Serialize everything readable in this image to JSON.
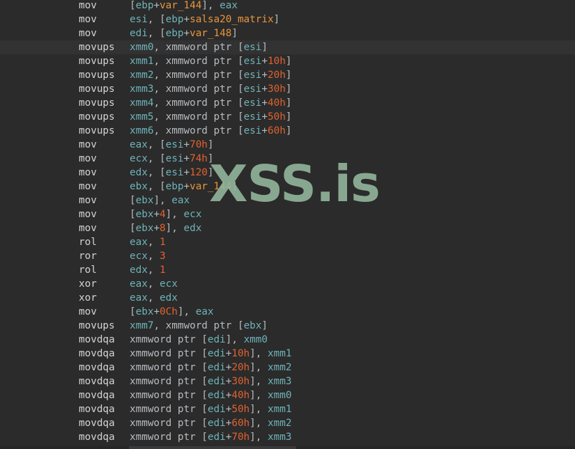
{
  "watermark": "XSS.is",
  "colors": {
    "background": "#2b2b2b",
    "current_line": "#323232",
    "mnemonic": "#d4d4d4",
    "register": "#6fb3b8",
    "punctuation": "#b8bcc0",
    "symbol": "#e8963a",
    "number": "#e0622f",
    "watermark": "#93b59c"
  },
  "lines": [
    {
      "mnemonic": "mov",
      "operands": [
        [
          "p",
          "["
        ],
        [
          "r",
          "ebp"
        ],
        [
          "p",
          "+"
        ],
        [
          "s",
          "var_144"
        ],
        [
          "p",
          "], "
        ],
        [
          "r",
          "eax"
        ]
      ]
    },
    {
      "mnemonic": "mov",
      "operands": [
        [
          "r",
          "esi"
        ],
        [
          "p",
          ", ["
        ],
        [
          "r",
          "ebp"
        ],
        [
          "p",
          "+"
        ],
        [
          "s",
          "salsa20_matrix"
        ],
        [
          "p",
          "]"
        ]
      ]
    },
    {
      "mnemonic": "mov",
      "operands": [
        [
          "r",
          "edi"
        ],
        [
          "p",
          ", ["
        ],
        [
          "r",
          "ebp"
        ],
        [
          "p",
          "+"
        ],
        [
          "s",
          "var_148"
        ],
        [
          "p",
          "]"
        ]
      ]
    },
    {
      "mnemonic": "movups",
      "current": true,
      "operands": [
        [
          "r",
          "xmm0"
        ],
        [
          "p",
          ", "
        ],
        [
          "k",
          "xmmword ptr "
        ],
        [
          "p",
          "["
        ],
        [
          "r",
          "esi"
        ],
        [
          "p",
          "]"
        ]
      ]
    },
    {
      "mnemonic": "movups",
      "operands": [
        [
          "r",
          "xmm1"
        ],
        [
          "p",
          ", "
        ],
        [
          "k",
          "xmmword ptr "
        ],
        [
          "p",
          "["
        ],
        [
          "r",
          "esi"
        ],
        [
          "p",
          "+"
        ],
        [
          "n",
          "10h"
        ],
        [
          "p",
          "]"
        ]
      ]
    },
    {
      "mnemonic": "movups",
      "operands": [
        [
          "r",
          "xmm2"
        ],
        [
          "p",
          ", "
        ],
        [
          "k",
          "xmmword ptr "
        ],
        [
          "p",
          "["
        ],
        [
          "r",
          "esi"
        ],
        [
          "p",
          "+"
        ],
        [
          "n",
          "20h"
        ],
        [
          "p",
          "]"
        ]
      ]
    },
    {
      "mnemonic": "movups",
      "operands": [
        [
          "r",
          "xmm3"
        ],
        [
          "p",
          ", "
        ],
        [
          "k",
          "xmmword ptr "
        ],
        [
          "p",
          "["
        ],
        [
          "r",
          "esi"
        ],
        [
          "p",
          "+"
        ],
        [
          "n",
          "30h"
        ],
        [
          "p",
          "]"
        ]
      ]
    },
    {
      "mnemonic": "movups",
      "operands": [
        [
          "r",
          "xmm4"
        ],
        [
          "p",
          ", "
        ],
        [
          "k",
          "xmmword ptr "
        ],
        [
          "p",
          "["
        ],
        [
          "r",
          "esi"
        ],
        [
          "p",
          "+"
        ],
        [
          "n",
          "40h"
        ],
        [
          "p",
          "]"
        ]
      ]
    },
    {
      "mnemonic": "movups",
      "operands": [
        [
          "r",
          "xmm5"
        ],
        [
          "p",
          ", "
        ],
        [
          "k",
          "xmmword ptr "
        ],
        [
          "p",
          "["
        ],
        [
          "r",
          "esi"
        ],
        [
          "p",
          "+"
        ],
        [
          "n",
          "50h"
        ],
        [
          "p",
          "]"
        ]
      ]
    },
    {
      "mnemonic": "movups",
      "operands": [
        [
          "r",
          "xmm6"
        ],
        [
          "p",
          ", "
        ],
        [
          "k",
          "xmmword ptr "
        ],
        [
          "p",
          "["
        ],
        [
          "r",
          "esi"
        ],
        [
          "p",
          "+"
        ],
        [
          "n",
          "60h"
        ],
        [
          "p",
          "]"
        ]
      ]
    },
    {
      "mnemonic": "mov",
      "operands": [
        [
          "r",
          "eax"
        ],
        [
          "p",
          ", ["
        ],
        [
          "r",
          "esi"
        ],
        [
          "p",
          "+"
        ],
        [
          "n",
          "70h"
        ],
        [
          "p",
          "]"
        ]
      ]
    },
    {
      "mnemonic": "mov",
      "operands": [
        [
          "r",
          "ecx"
        ],
        [
          "p",
          ", ["
        ],
        [
          "r",
          "esi"
        ],
        [
          "p",
          "+"
        ],
        [
          "n",
          "74h"
        ],
        [
          "p",
          "]"
        ]
      ]
    },
    {
      "mnemonic": "mov",
      "operands": [
        [
          "r",
          "edx"
        ],
        [
          "p",
          ", ["
        ],
        [
          "r",
          "esi"
        ],
        [
          "p",
          "+"
        ],
        [
          "n",
          "120"
        ],
        [
          "p",
          "]"
        ]
      ]
    },
    {
      "mnemonic": "mov",
      "operands": [
        [
          "r",
          "ebx"
        ],
        [
          "p",
          ", ["
        ],
        [
          "r",
          "ebp"
        ],
        [
          "p",
          "+"
        ],
        [
          "s",
          "var_144"
        ],
        [
          "p",
          "]"
        ]
      ]
    },
    {
      "mnemonic": "mov",
      "operands": [
        [
          "p",
          "["
        ],
        [
          "r",
          "ebx"
        ],
        [
          "p",
          "], "
        ],
        [
          "r",
          "eax"
        ]
      ]
    },
    {
      "mnemonic": "mov",
      "operands": [
        [
          "p",
          "["
        ],
        [
          "r",
          "ebx"
        ],
        [
          "p",
          "+"
        ],
        [
          "n",
          "4"
        ],
        [
          "p",
          "], "
        ],
        [
          "r",
          "ecx"
        ]
      ]
    },
    {
      "mnemonic": "mov",
      "operands": [
        [
          "p",
          "["
        ],
        [
          "r",
          "ebx"
        ],
        [
          "p",
          "+"
        ],
        [
          "n",
          "8"
        ],
        [
          "p",
          "], "
        ],
        [
          "r",
          "edx"
        ]
      ]
    },
    {
      "mnemonic": "rol",
      "operands": [
        [
          "r",
          "eax"
        ],
        [
          "p",
          ", "
        ],
        [
          "n",
          "1"
        ]
      ]
    },
    {
      "mnemonic": "ror",
      "operands": [
        [
          "r",
          "ecx"
        ],
        [
          "p",
          ", "
        ],
        [
          "n",
          "3"
        ]
      ]
    },
    {
      "mnemonic": "rol",
      "operands": [
        [
          "r",
          "edx"
        ],
        [
          "p",
          ", "
        ],
        [
          "n",
          "1"
        ]
      ]
    },
    {
      "mnemonic": "xor",
      "operands": [
        [
          "r",
          "eax"
        ],
        [
          "p",
          ", "
        ],
        [
          "r",
          "ecx"
        ]
      ]
    },
    {
      "mnemonic": "xor",
      "operands": [
        [
          "r",
          "eax"
        ],
        [
          "p",
          ", "
        ],
        [
          "r",
          "edx"
        ]
      ]
    },
    {
      "mnemonic": "mov",
      "operands": [
        [
          "p",
          "["
        ],
        [
          "r",
          "ebx"
        ],
        [
          "p",
          "+"
        ],
        [
          "n",
          "0Ch"
        ],
        [
          "p",
          "], "
        ],
        [
          "r",
          "eax"
        ]
      ]
    },
    {
      "mnemonic": "movups",
      "operands": [
        [
          "r",
          "xmm7"
        ],
        [
          "p",
          ", "
        ],
        [
          "k",
          "xmmword ptr "
        ],
        [
          "p",
          "["
        ],
        [
          "r",
          "ebx"
        ],
        [
          "p",
          "]"
        ]
      ]
    },
    {
      "mnemonic": "movdqa",
      "operands": [
        [
          "k",
          "xmmword ptr "
        ],
        [
          "p",
          "["
        ],
        [
          "r",
          "edi"
        ],
        [
          "p",
          "], "
        ],
        [
          "r",
          "xmm0"
        ]
      ]
    },
    {
      "mnemonic": "movdqa",
      "operands": [
        [
          "k",
          "xmmword ptr "
        ],
        [
          "p",
          "["
        ],
        [
          "r",
          "edi"
        ],
        [
          "p",
          "+"
        ],
        [
          "n",
          "10h"
        ],
        [
          "p",
          "], "
        ],
        [
          "r",
          "xmm1"
        ]
      ]
    },
    {
      "mnemonic": "movdqa",
      "operands": [
        [
          "k",
          "xmmword ptr "
        ],
        [
          "p",
          "["
        ],
        [
          "r",
          "edi"
        ],
        [
          "p",
          "+"
        ],
        [
          "n",
          "20h"
        ],
        [
          "p",
          "], "
        ],
        [
          "r",
          "xmm2"
        ]
      ]
    },
    {
      "mnemonic": "movdqa",
      "operands": [
        [
          "k",
          "xmmword ptr "
        ],
        [
          "p",
          "["
        ],
        [
          "r",
          "edi"
        ],
        [
          "p",
          "+"
        ],
        [
          "n",
          "30h"
        ],
        [
          "p",
          "], "
        ],
        [
          "r",
          "xmm3"
        ]
      ]
    },
    {
      "mnemonic": "movdqa",
      "operands": [
        [
          "k",
          "xmmword ptr "
        ],
        [
          "p",
          "["
        ],
        [
          "r",
          "edi"
        ],
        [
          "p",
          "+"
        ],
        [
          "n",
          "40h"
        ],
        [
          "p",
          "], "
        ],
        [
          "r",
          "xmm0"
        ]
      ]
    },
    {
      "mnemonic": "movdqa",
      "operands": [
        [
          "k",
          "xmmword ptr "
        ],
        [
          "p",
          "["
        ],
        [
          "r",
          "edi"
        ],
        [
          "p",
          "+"
        ],
        [
          "n",
          "50h"
        ],
        [
          "p",
          "], "
        ],
        [
          "r",
          "xmm1"
        ]
      ]
    },
    {
      "mnemonic": "movdqa",
      "operands": [
        [
          "k",
          "xmmword ptr "
        ],
        [
          "p",
          "["
        ],
        [
          "r",
          "edi"
        ],
        [
          "p",
          "+"
        ],
        [
          "n",
          "60h"
        ],
        [
          "p",
          "], "
        ],
        [
          "r",
          "xmm2"
        ]
      ]
    },
    {
      "mnemonic": "movdqa",
      "operands": [
        [
          "k",
          "xmmword ptr "
        ],
        [
          "p",
          "["
        ],
        [
          "r",
          "edi"
        ],
        [
          "p",
          "+"
        ],
        [
          "n",
          "70h"
        ],
        [
          "p",
          "], "
        ],
        [
          "r",
          "xmm3"
        ]
      ]
    }
  ]
}
